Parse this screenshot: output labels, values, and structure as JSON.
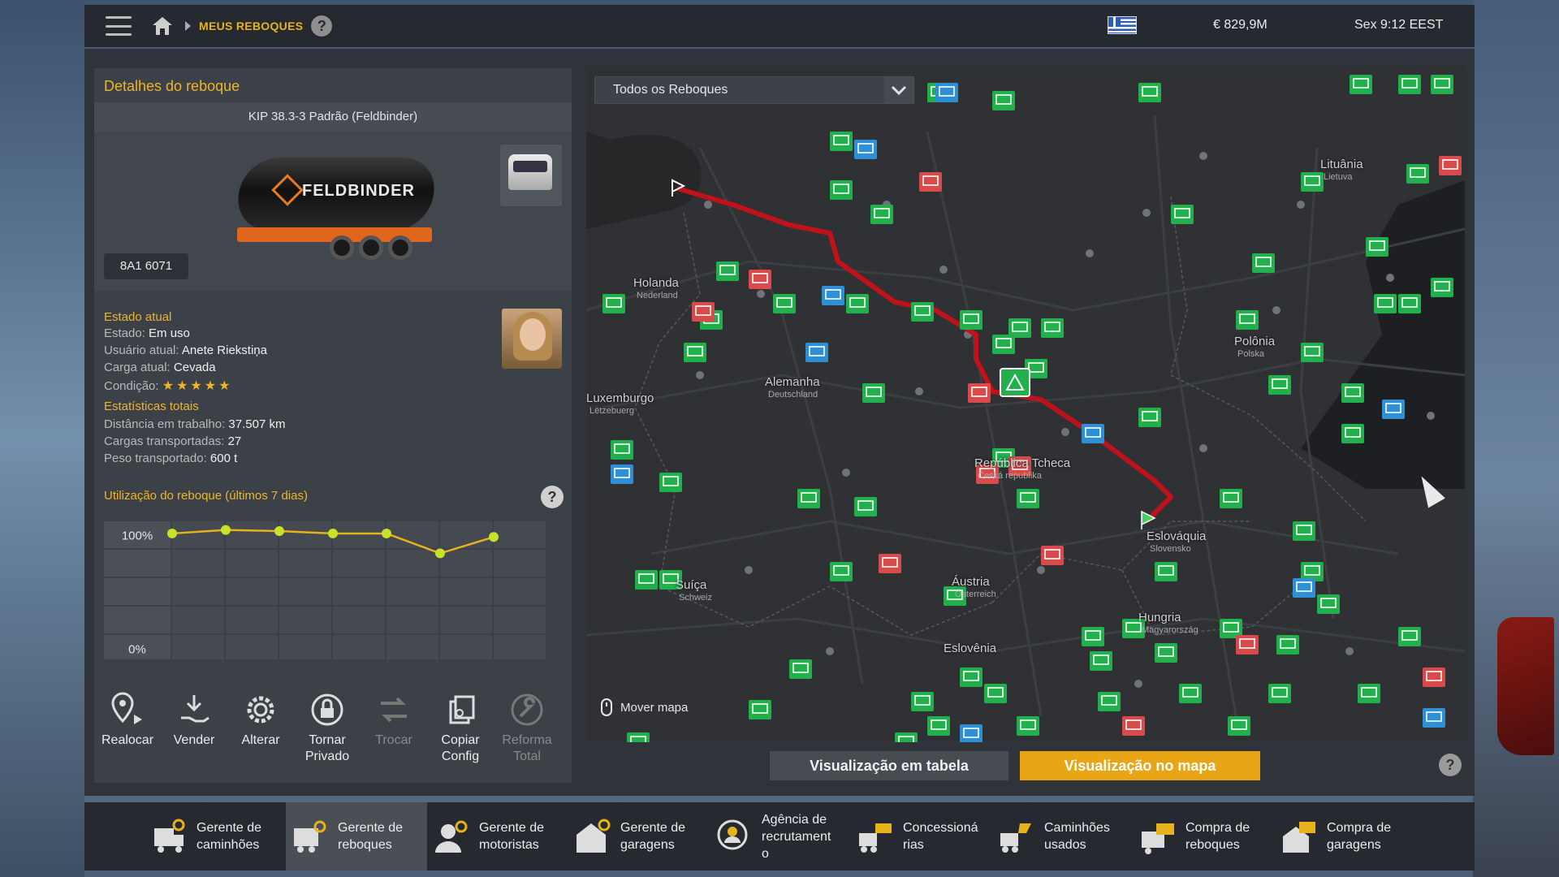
{
  "topbar": {
    "breadcrumb": "MEUS REBOQUES",
    "help": "?",
    "money": "€ 829,9M",
    "time": "Sex 9:12 EEST"
  },
  "details": {
    "title": "Detalhes do reboque",
    "trailer_name": "KIP 38.3-3 Padrão (Feldbinder)",
    "brand_logo": "FELDBINDER",
    "plate": "8A1 6071",
    "current_state_title": "Estado atual",
    "status_label": "Estado:",
    "status_value": "Em uso",
    "user_label": "Usuário atual:",
    "user_value": "Anete Riekstiņa",
    "cargo_label": "Carga atual:",
    "cargo_value": "Cevada",
    "condition_label": "Condição:",
    "condition_stars": 5,
    "stats_title": "Estatísticas totais",
    "distance_label": "Distância em trabalho:",
    "distance_value": "37.507 km",
    "loads_label": "Cargas transportadas:",
    "loads_value": "27",
    "weight_label": "Peso transportado:",
    "weight_value": "600 t",
    "usage_title": "Utilização do reboque (últimos 7 dias)",
    "usage_help": "?"
  },
  "chart_data": {
    "type": "line",
    "title": "Utilização do reboque (últimos 7 dias)",
    "x": [
      1,
      2,
      3,
      4,
      5,
      6,
      7
    ],
    "values": [
      99,
      102,
      101,
      99,
      99,
      82,
      96
    ],
    "y_tick_labels": [
      "100%",
      "0%"
    ],
    "ylim": [
      0,
      100
    ],
    "grid": true,
    "line_color": "#e8b21c",
    "point_color": "#c8e22a"
  },
  "actions": [
    {
      "label": "Realocar",
      "icon": "relocate-pin-icon",
      "enabled": true
    },
    {
      "label": "Vender",
      "icon": "sell-hand-icon",
      "enabled": true
    },
    {
      "label": "Alterar",
      "icon": "gear-icon",
      "enabled": true
    },
    {
      "label": "Tornar Privado",
      "icon": "lock-icon",
      "enabled": true
    },
    {
      "label": "Trocar",
      "icon": "swap-arrows-icon",
      "enabled": false
    },
    {
      "label": "Copiar Config",
      "icon": "copy-config-icon",
      "enabled": true
    },
    {
      "label": "Reforma Total",
      "icon": "wrench-icon",
      "enabled": false
    }
  ],
  "map": {
    "filter": "Todos os Reboques",
    "move_map": "Mover mapa",
    "labels": [
      {
        "name": "Lituânia",
        "sub": "Lietuva"
      },
      {
        "name": "Holanda",
        "sub": "Nederland"
      },
      {
        "name": "Polônia",
        "sub": "Polska"
      },
      {
        "name": "Alemanha",
        "sub": "Deutschland"
      },
      {
        "name": "Luxemburgo",
        "sub": "Lëtzebuerg"
      },
      {
        "name": "República Tcheca",
        "sub": "Česká republika"
      },
      {
        "name": "Eslováquia",
        "sub": "Slovensko"
      },
      {
        "name": "Suíça",
        "sub": "Schweiz"
      },
      {
        "name": "Áustria",
        "sub": "Österreich"
      },
      {
        "name": "Hungria",
        "sub": "Magyarország"
      },
      {
        "name": "Eslovênia",
        "sub": ""
      }
    ],
    "icon_colors": {
      "green": "#21b04b",
      "red": "#d94a4a",
      "blue": "#2d8fd6",
      "route": "#c0121a"
    }
  },
  "view_buttons": {
    "table": "Visualização em tabela",
    "map": "Visualização no mapa",
    "help": "?"
  },
  "bottom_nav": [
    {
      "line1": "Gerente de",
      "line2": "caminhões",
      "icon": "truck-manager-icon",
      "active": false
    },
    {
      "line1": "Gerente de",
      "line2": "reboques",
      "icon": "trailer-manager-icon",
      "active": true
    },
    {
      "line1": "Gerente de",
      "line2": "motoristas",
      "icon": "driver-manager-icon",
      "active": false
    },
    {
      "line1": "Gerente de",
      "line2": "garagens",
      "icon": "garage-manager-icon",
      "active": false
    },
    {
      "line1": "Agência de",
      "line2": "recrutament",
      "line3": "o",
      "icon": "recruitment-icon",
      "active": false
    },
    {
      "line1": "Concessioná",
      "line2": "rias",
      "icon": "dealership-icon",
      "active": false
    },
    {
      "line1": "Caminhões",
      "line2": "usados",
      "icon": "used-trucks-icon",
      "active": false
    },
    {
      "line1": "Compra de",
      "line2": "reboques",
      "icon": "buy-trailers-icon",
      "active": false
    },
    {
      "line1": "Compra de",
      "line2": "garagens",
      "icon": "buy-garages-icon",
      "active": false
    }
  ]
}
